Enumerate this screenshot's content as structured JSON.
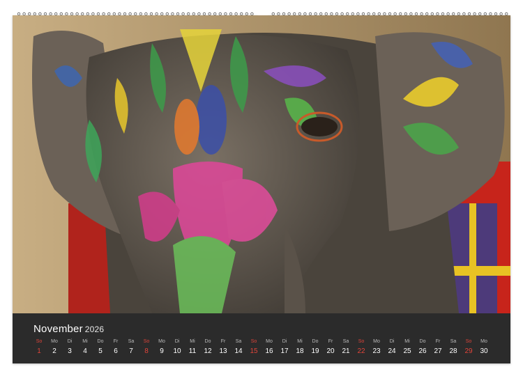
{
  "calendar": {
    "month": "November",
    "year": "2026",
    "days": [
      {
        "wd": "So",
        "dn": "1",
        "sunday": true
      },
      {
        "wd": "Mo",
        "dn": "2"
      },
      {
        "wd": "Di",
        "dn": "3"
      },
      {
        "wd": "Mi",
        "dn": "4"
      },
      {
        "wd": "Do",
        "dn": "5"
      },
      {
        "wd": "Fr",
        "dn": "6"
      },
      {
        "wd": "Sa",
        "dn": "7"
      },
      {
        "wd": "So",
        "dn": "8",
        "sunday": true
      },
      {
        "wd": "Mo",
        "dn": "9"
      },
      {
        "wd": "Di",
        "dn": "10"
      },
      {
        "wd": "Mi",
        "dn": "11"
      },
      {
        "wd": "Do",
        "dn": "12"
      },
      {
        "wd": "Fr",
        "dn": "13"
      },
      {
        "wd": "Sa",
        "dn": "14"
      },
      {
        "wd": "So",
        "dn": "15",
        "sunday": true
      },
      {
        "wd": "Mo",
        "dn": "16"
      },
      {
        "wd": "Di",
        "dn": "17"
      },
      {
        "wd": "Mi",
        "dn": "18"
      },
      {
        "wd": "Do",
        "dn": "19"
      },
      {
        "wd": "Fr",
        "dn": "20"
      },
      {
        "wd": "Sa",
        "dn": "21"
      },
      {
        "wd": "So",
        "dn": "22",
        "sunday": true
      },
      {
        "wd": "Mo",
        "dn": "23"
      },
      {
        "wd": "Di",
        "dn": "24"
      },
      {
        "wd": "Mi",
        "dn": "25"
      },
      {
        "wd": "Do",
        "dn": "26"
      },
      {
        "wd": "Fr",
        "dn": "27"
      },
      {
        "wd": "Sa",
        "dn": "28"
      },
      {
        "wd": "So",
        "dn": "29",
        "sunday": true
      },
      {
        "wd": "Mo",
        "dn": "30"
      }
    ]
  },
  "colors": {
    "strip": "#2b2b2b",
    "sunday": "#e0443a",
    "weekday": "#ffffff"
  },
  "icons": {
    "binding": "spiral-binding-icon",
    "hanger": "hanger-hole-icon"
  }
}
